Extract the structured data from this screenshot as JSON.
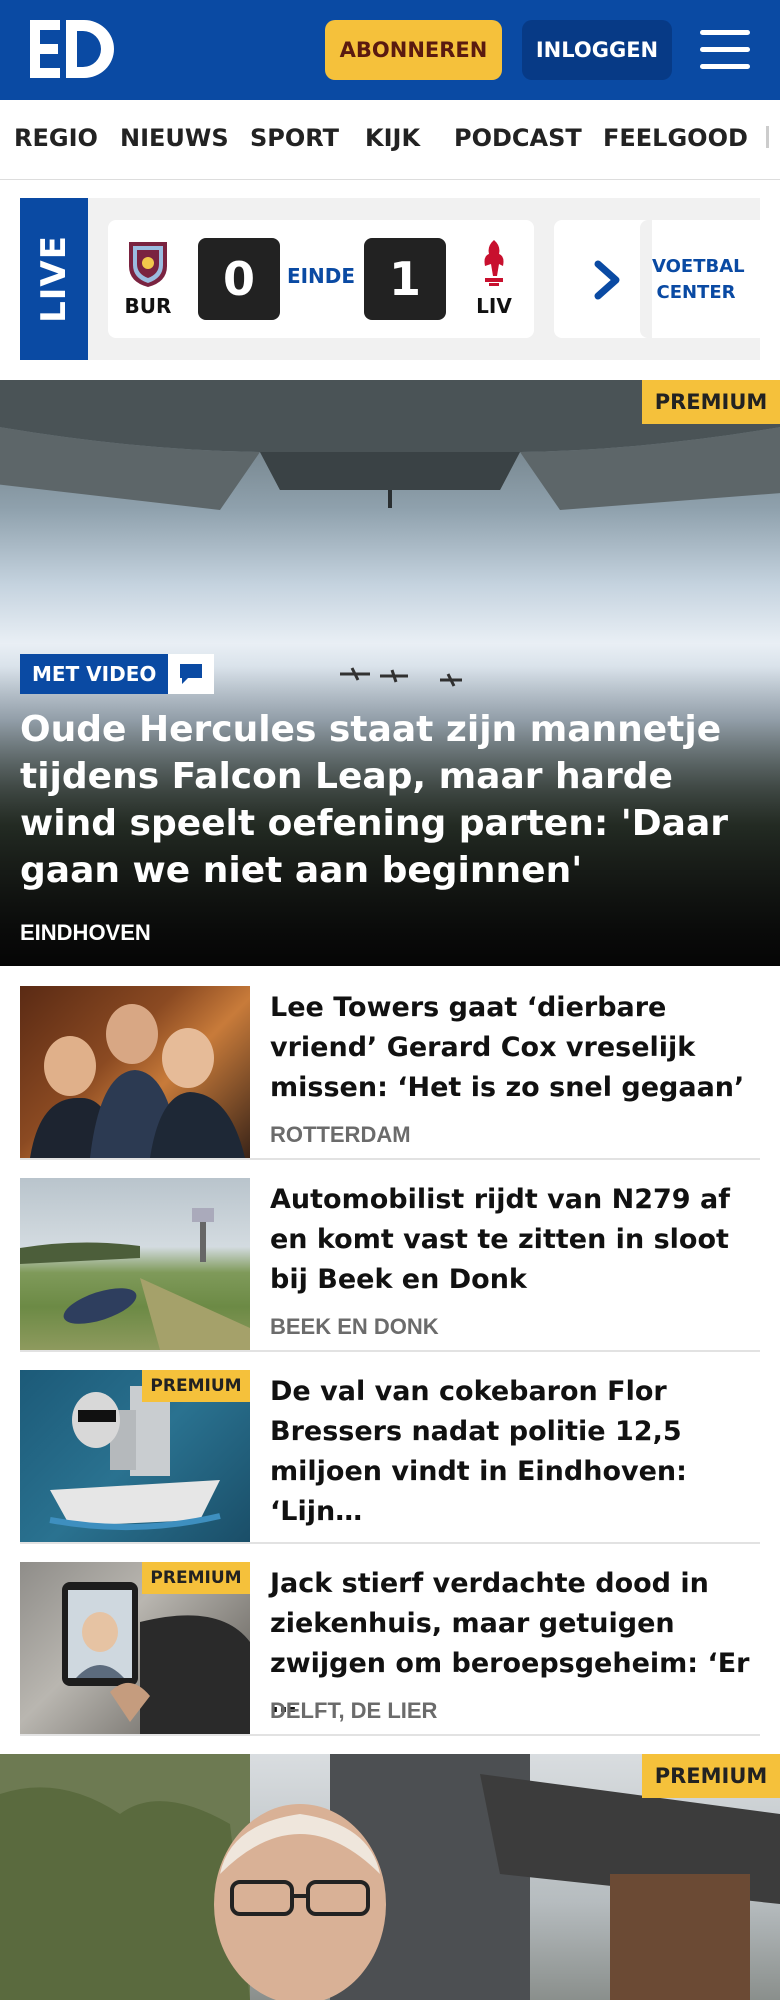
{
  "header": {
    "logo_text": "ED",
    "subscribe_label": "ABONNEREN",
    "login_label": "INLOGGEN",
    "colors": {
      "brand": "#0a4aa3",
      "accent": "#f5c13b"
    }
  },
  "nav": {
    "items": [
      "REGIO",
      "NIEUWS",
      "SPORT",
      "KIJK",
      "PODCAST",
      "FEELGOOD"
    ]
  },
  "live": {
    "tag": "LIVE",
    "home_team": "BUR",
    "home_score": "0",
    "status": "EINDE",
    "away_score": "1",
    "away_team": "LIV",
    "center_label": "VOETBAL CENTER"
  },
  "hero": {
    "premium_label": "PREMIUM",
    "video_label": "MET VIDEO",
    "title": "Oude Hercules staat zijn mannetje tijdens Falcon Leap, maar harde wind speelt oefening parten: 'Daar gaan we niet aan beginnen'",
    "location": "EINDHOVEN"
  },
  "articles": [
    {
      "title": "Lee Towers gaat ‘dierbare vriend’ Gerard Cox vreselijk missen: ‘Het is zo snel gegaan’",
      "location": "ROTTERDAM",
      "premium": ""
    },
    {
      "title": "Automobilist rijdt van N279 af en komt vast te zitten in sloot bij Beek en Donk",
      "location": "BEEK EN DONK",
      "premium": ""
    },
    {
      "title": "De val van cokebaron Flor Bressers nadat politie 12,5 miljoen vindt in Eindhoven: ‘Lijn…",
      "location": "",
      "premium": "PREMIUM"
    },
    {
      "title": "Jack stierf verdachte dood in ziekenhuis, maar getuigen zwijgen om beroepsgeheim: ‘Er …",
      "location": "DELFT, DE LIER",
      "premium": "PREMIUM"
    }
  ],
  "hero2": {
    "premium_label": "PREMIUM"
  }
}
